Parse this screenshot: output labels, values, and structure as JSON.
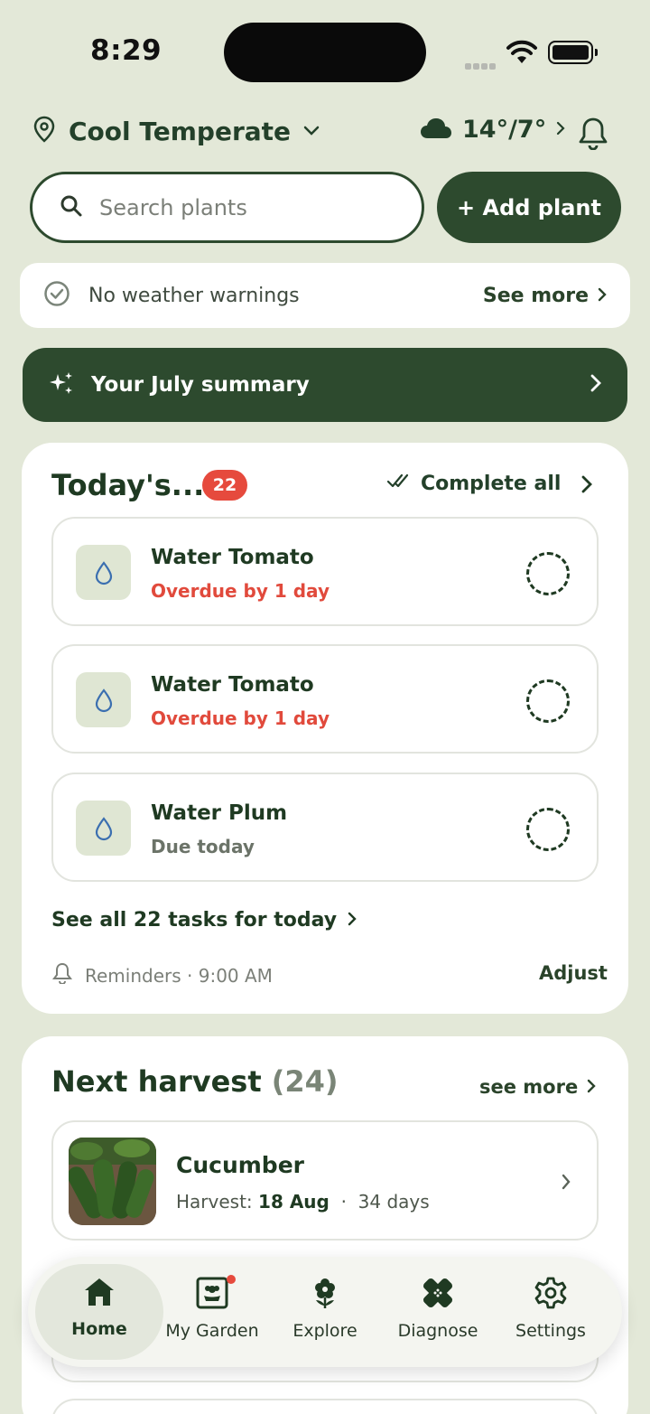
{
  "status_bar": {
    "time": "8:29"
  },
  "header": {
    "location": "Cool Temperate",
    "weather_temp": "14°/7°"
  },
  "search": {
    "placeholder": "Search plants",
    "add_label": "+ Add plant"
  },
  "warnings": {
    "text": "No weather warnings",
    "more_label": "See more"
  },
  "summary": {
    "label": "Your July summary"
  },
  "today": {
    "title": "Today's...",
    "count": "22",
    "complete_label": "Complete all",
    "tasks": [
      {
        "name": "Water Tomato",
        "due": "Overdue by 1 day",
        "status": "overdue"
      },
      {
        "name": "Water Tomato",
        "due": "Overdue by 1 day",
        "status": "overdue"
      },
      {
        "name": "Water Plum",
        "due": "Due today",
        "status": "today"
      }
    ],
    "see_all": "See all 22 tasks for today",
    "reminder": "Reminders · 9:00 AM",
    "adjust": "Adjust"
  },
  "harvest": {
    "title": "Next harvest",
    "count": "(24)",
    "see_more": "see more",
    "items": [
      {
        "name": "Cucumber",
        "harvest_prefix": "Harvest:",
        "date": "18 Aug",
        "sep": "·",
        "days": "34 days"
      }
    ]
  },
  "nav": {
    "items": [
      {
        "label": "Home",
        "icon": "home-icon",
        "active": true
      },
      {
        "label": "My Garden",
        "icon": "garden-icon"
      },
      {
        "label": "Explore",
        "icon": "flower-icon"
      },
      {
        "label": "Diagnose",
        "icon": "bandage-icon"
      },
      {
        "label": "Settings",
        "icon": "gear-icon"
      }
    ]
  },
  "colors": {
    "primary": "#2d4a2e",
    "background": "#e3e8d8",
    "danger": "#e64a3d"
  }
}
